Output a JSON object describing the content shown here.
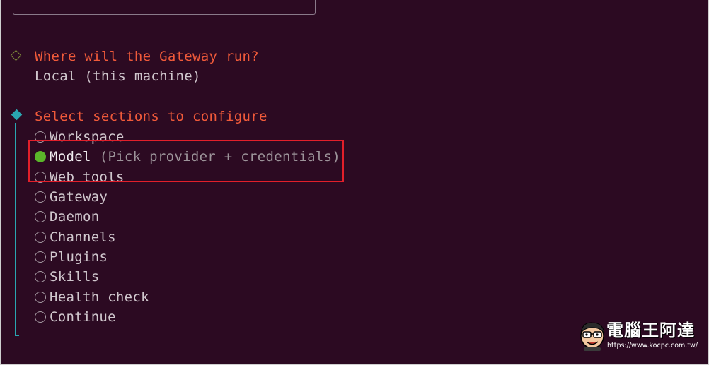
{
  "steps": {
    "gateway_location": {
      "question": "Where will the Gateway run?",
      "answer": "Local (this machine)"
    },
    "sections": {
      "question": "Select sections to configure",
      "options": [
        {
          "label": "Workspace",
          "selected": false
        },
        {
          "label": "Model",
          "hint": "(Pick provider + credentials)",
          "selected": true
        },
        {
          "label": "Web tools",
          "selected": false
        },
        {
          "label": "Gateway",
          "selected": false
        },
        {
          "label": "Daemon",
          "selected": false
        },
        {
          "label": "Channels",
          "selected": false
        },
        {
          "label": "Plugins",
          "selected": false
        },
        {
          "label": "Skills",
          "selected": false
        },
        {
          "label": "Health check",
          "selected": false
        },
        {
          "label": "Continue",
          "selected": false
        }
      ]
    }
  },
  "colors": {
    "background": "#2c0a22",
    "question": "#f05a3a",
    "active_rail": "#2aa6b0",
    "selected_radio": "#5bb52a",
    "highlight_box": "#e21f2a"
  },
  "watermark": {
    "title": "電腦王阿達",
    "url": "https://www.kocpc.com.tw/"
  }
}
